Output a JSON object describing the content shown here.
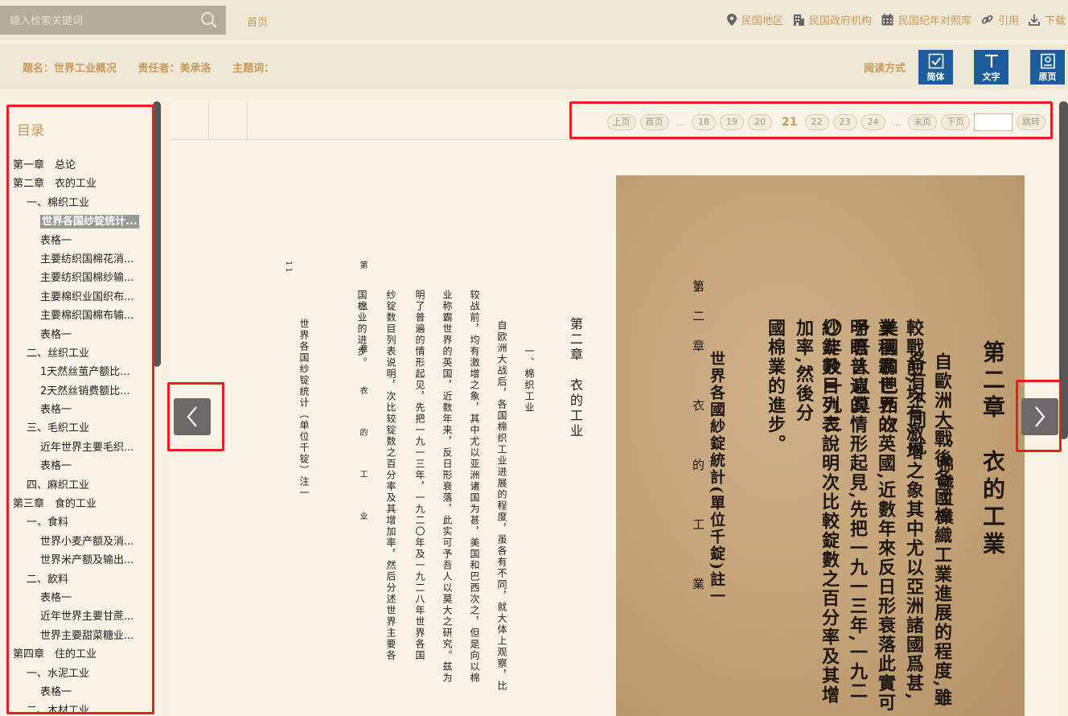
{
  "search": {
    "placeholder": "输入检索关键词"
  },
  "nav": {
    "home": "首页"
  },
  "top_links": [
    {
      "icon": "map-pin-icon",
      "label": "民国地区"
    },
    {
      "icon": "building-icon",
      "label": "民国政府机构"
    },
    {
      "icon": "calendar-icon",
      "label": "民国纪年对照库"
    },
    {
      "icon": "link-icon",
      "label": "引用"
    },
    {
      "icon": "download-icon",
      "label": "下载"
    }
  ],
  "meta": {
    "title": "题名：世界工业概况",
    "author": "责任者：美承洛",
    "keywords": "主题词："
  },
  "read_mode": {
    "label": "阅读方式",
    "simplified": "简体",
    "text": "文字",
    "original": "原页"
  },
  "toc": {
    "title": "目录",
    "items": [
      {
        "level": 0,
        "label": "第一章　总论"
      },
      {
        "level": 0,
        "label": "第二章　衣的工业"
      },
      {
        "level": 1,
        "label": "一、棉织工业"
      },
      {
        "level": 2,
        "label": "世界各国纱锭统计...",
        "active": true
      },
      {
        "level": 2,
        "label": "表格一"
      },
      {
        "level": 2,
        "label": "主要纺织国棉花消..."
      },
      {
        "level": 2,
        "label": "主要纺织国棉纱输..."
      },
      {
        "level": 2,
        "label": "主要棉织业国织布..."
      },
      {
        "level": 2,
        "label": "主要棉织国棉布输..."
      },
      {
        "level": 2,
        "label": "表格一"
      },
      {
        "level": 1,
        "label": "二、丝织工业"
      },
      {
        "level": 2,
        "label": "1天然丝茧产额比..."
      },
      {
        "level": 2,
        "label": "2天然丝销费额比..."
      },
      {
        "level": 2,
        "label": "表格一"
      },
      {
        "level": 1,
        "label": "三、毛织工业"
      },
      {
        "level": 2,
        "label": "近年世界主要毛织..."
      },
      {
        "level": 2,
        "label": "表格一"
      },
      {
        "level": 1,
        "label": "四、麻织工业"
      },
      {
        "level": 0,
        "label": "第三章　食的工业"
      },
      {
        "level": 1,
        "label": "一、食料"
      },
      {
        "level": 2,
        "label": "世界小麦产额及消..."
      },
      {
        "level": 2,
        "label": "世界米产额及输出..."
      },
      {
        "level": 1,
        "label": "二、飲料"
      },
      {
        "level": 2,
        "label": "表格一"
      },
      {
        "level": 2,
        "label": "近年世界主要甘蔗..."
      },
      {
        "level": 2,
        "label": "世界主要甜菜糖业..."
      },
      {
        "level": 0,
        "label": "第四章　住的工业"
      },
      {
        "level": 1,
        "label": "一、水泥工业"
      },
      {
        "level": 2,
        "label": "表格一"
      },
      {
        "level": 1,
        "label": "二、木材工业"
      }
    ]
  },
  "pager": {
    "prev": "上页",
    "first": "首页",
    "dots": "...",
    "pages": [
      "18",
      "19",
      "20"
    ],
    "current": "21",
    "pages_after": [
      "22",
      "23",
      "24"
    ],
    "last": "末页",
    "next": "下页",
    "go": "跳转"
  },
  "text_page": {
    "page_no": "11",
    "header": "第　二　章　衣　的　工　业",
    "chapter": "第二章　衣的工业",
    "section": "一、棉织工业",
    "para": [
      "自欧洲大战后，各国棉织工业进展的程度，虽各有不同，就大体上观察，比",
      "较战前，均有激增之象，其中尤以亚洲诸国为甚，美国和巴西次之，但是向以棉",
      "业称霸世界的英国，近数年来，反日形衰落，此实可予吾人以莫大之研究。兹为",
      "明了普遍的情形起见，先把一九一三年，一九二〇年及一九二八年世界各国",
      "纱锭数目列表说明，次比较锭数之百分率及其增加率，然后分述世界主要各",
      "国棉业的进步。"
    ],
    "table_title": "世界各国纱锭统计（单位千锭）注一"
  },
  "scan_page": {
    "page_no": "11",
    "header": "第二章　衣　的　工　業",
    "chapter": "第二章　衣的工業",
    "section": "一、棉織工業",
    "cols": [
      "自歐洲大戰後各國棉織工業進展的程度,雖各有不同,就",
      "較戰前,均有激增之象其中尤以亞洲諸國爲甚,美國和巴西次",
      "業稱霸世界的英國,近數年來反日形衰落此實可予吾人以莫",
      "明瞭普遍的情形起見,先把一九一三年,一九二〇年及一九二",
      "紗錠數目列表說明次比較錠數之百分率及其增加率,然後分",
      "國棉業的進步。"
    ],
    "table_title": "世界各國紗錠統計(單位千錠)註一"
  }
}
